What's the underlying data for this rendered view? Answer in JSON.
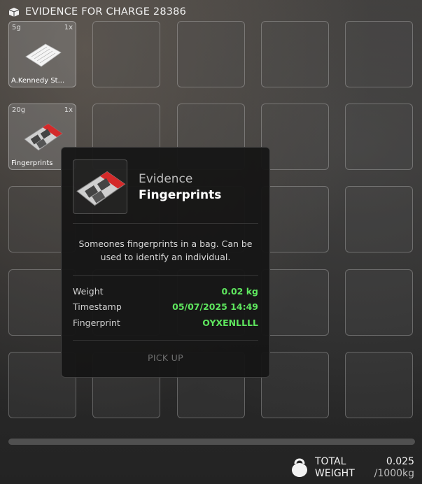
{
  "header": {
    "icon": "evidence-box-icon",
    "title": "EVIDENCE FOR CHARGE 28386"
  },
  "items": [
    {
      "weight": "5g",
      "quantity": "1x",
      "name": "A.Kennedy St...",
      "icon": "document-paper-icon"
    },
    {
      "weight": "20g",
      "quantity": "1x",
      "name": "Fingerprints",
      "icon": "fingerprint-bag-icon"
    }
  ],
  "tooltip": {
    "category": "Evidence",
    "name": "Fingerprints",
    "description": "Someones fingerprints in a bag. Can be used to identify an individual.",
    "rows": [
      {
        "label": "Weight",
        "value": "0.02 kg"
      },
      {
        "label": "Timestamp",
        "value": "05/07/2025 14:49"
      },
      {
        "label": "Fingerprint",
        "value": "OYXENLLLL"
      }
    ],
    "action": "PICK UP"
  },
  "footer": {
    "weight_label_line1": "TOTAL",
    "weight_label_line2": "WEIGHT",
    "current_weight": "0.025",
    "max_weight": "/1000kg",
    "icon": "kettlebell-icon"
  },
  "colors": {
    "value_green": "#5ee65e",
    "panel_bg": "#161616"
  }
}
